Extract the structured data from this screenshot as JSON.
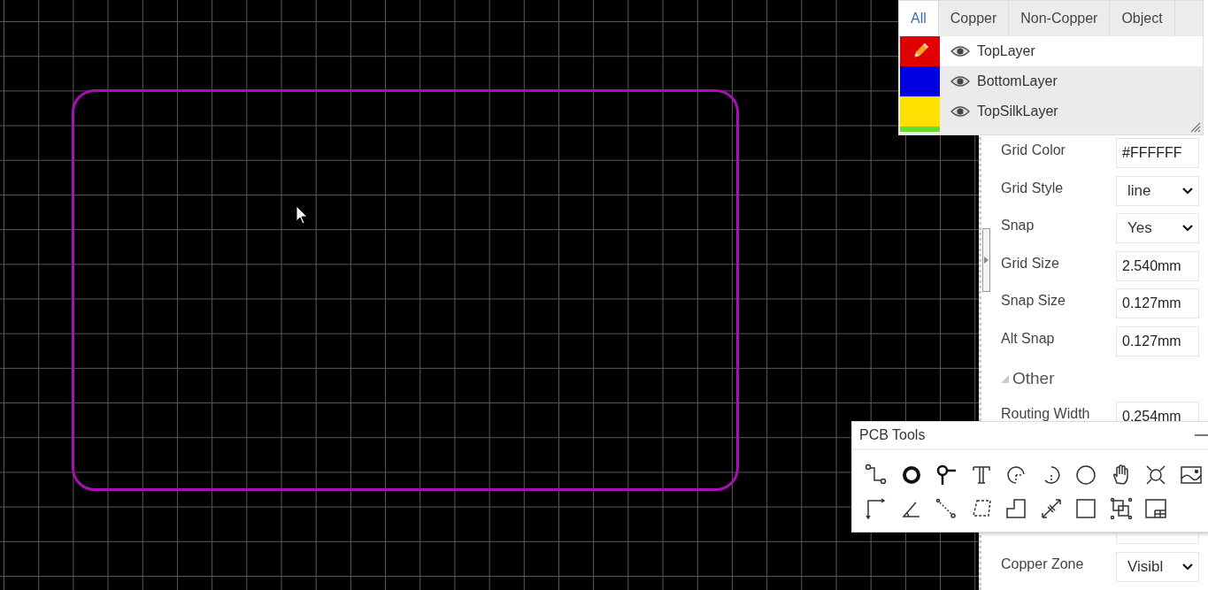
{
  "layer_panel": {
    "tabs": [
      {
        "label": "All",
        "selected": true
      },
      {
        "label": "Copper",
        "selected": false
      },
      {
        "label": "Non-Copper",
        "selected": false
      },
      {
        "label": "Object",
        "selected": false
      }
    ],
    "layers": [
      {
        "name": "TopLayer",
        "color": "#e00000",
        "selected": true,
        "visible": true
      },
      {
        "name": "BottomLayer",
        "color": "#0000e0",
        "selected": false,
        "visible": true
      },
      {
        "name": "TopSilkLayer",
        "color": "#ffe000",
        "selected": false,
        "visible": true
      },
      {
        "color": "#66dd33"
      }
    ]
  },
  "properties": {
    "rows": [
      {
        "label": "Grid Color",
        "kind": "text",
        "value": "#FFFFFF"
      },
      {
        "label": "Grid Style",
        "kind": "select",
        "value": "line"
      },
      {
        "label": "Snap",
        "kind": "select",
        "value": "Yes"
      },
      {
        "label": "Grid Size",
        "kind": "text",
        "value": "2.540mm"
      },
      {
        "label": "Snap Size",
        "kind": "text",
        "value": "0.127mm"
      },
      {
        "label": "Alt Snap",
        "kind": "text",
        "value": "0.127mm"
      },
      {
        "kind": "section",
        "label": "Other",
        "expanded": true
      },
      {
        "label": "Routing Width",
        "kind": "text",
        "value": "0.254mm"
      },
      {
        "kind": "spacer"
      },
      {
        "kind": "spacer"
      },
      {
        "kind": "hidden"
      },
      {
        "label": "Copper Zone",
        "kind": "select",
        "value": "Visibl"
      }
    ]
  },
  "pcb_tools": {
    "title": "PCB Tools"
  }
}
